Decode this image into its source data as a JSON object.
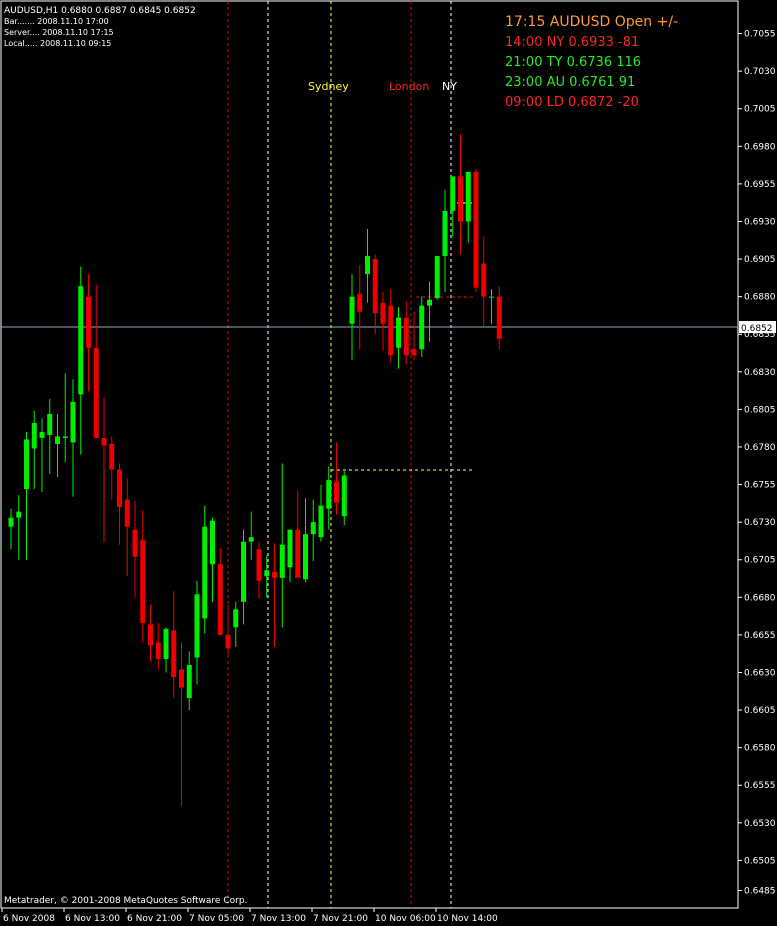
{
  "header": {
    "symbol_line": "AUDUSD,H1  0.6880 0.6887 0.6845 0.6852",
    "bar_line": "Bar....... 2008.11.10 17:00",
    "server_line": "Server.... 2008.11.10 17:15",
    "local_line": "Local..... 2008.11.10 09:15"
  },
  "sessions_panel": {
    "title": "17:15 AUDUSD Open +/-",
    "rows": [
      {
        "text": "14:00 NY  0.6933 -81",
        "color": "#ff2222"
      },
      {
        "text": "21:00 TY  0.6736 116",
        "color": "#22ee22"
      },
      {
        "text": "23:00 AU  0.6761 91",
        "color": "#22ee22"
      },
      {
        "text": "09:00 LD  0.6872 -20",
        "color": "#ff2222"
      }
    ],
    "title_color": "#ff9933"
  },
  "session_labels": [
    {
      "text": "Sydney",
      "color": "#ffff33"
    },
    {
      "text": "London",
      "color": "#ff2222"
    },
    {
      "text": "NY",
      "color": "#ffffff"
    }
  ],
  "footer": {
    "copyright": "Metatrader, © 2001-2008 MetaQuotes Software Corp."
  },
  "colors": {
    "background": "#000000",
    "bull": "#00ee00",
    "bear": "#ee0000",
    "axis": "#ffffff",
    "price_line": "#8ab0c8"
  },
  "chart_data": {
    "type": "candlestick",
    "symbol": "AUDUSD",
    "timeframe": "H1",
    "ylim": [
      0.648,
      0.707
    ],
    "y_ticks": [
      "0.7055",
      "0.7030",
      "0.7005",
      "0.6980",
      "0.6955",
      "0.6930",
      "0.6905",
      "0.6880",
      "0.6855",
      "0.6830",
      "0.6805",
      "0.6780",
      "0.6755",
      "0.6730",
      "0.6705",
      "0.6680",
      "0.6655",
      "0.6630",
      "0.6605",
      "0.6580",
      "0.6555",
      "0.6530",
      "0.6505",
      "0.6485"
    ],
    "x_labels": [
      "6 Nov 2008",
      "6 Nov 13:00",
      "6 Nov 21:00",
      "7 Nov 05:00",
      "7 Nov 13:00",
      "7 Nov 21:00",
      "10 Nov 06:00",
      "10 Nov 14:00"
    ],
    "x_label_bar_index": [
      0,
      8,
      16,
      24,
      32,
      40,
      48,
      56
    ],
    "current_price": "0.6852",
    "candles": [
      {
        "o": 0.6727,
        "h": 0.6739,
        "l": 0.6712,
        "c": 0.6733
      },
      {
        "o": 0.6733,
        "h": 0.6748,
        "l": 0.6705,
        "c": 0.6737
      },
      {
        "o": 0.6752,
        "h": 0.679,
        "l": 0.6705,
        "c": 0.6785
      },
      {
        "o": 0.6779,
        "h": 0.6804,
        "l": 0.6752,
        "c": 0.6796
      },
      {
        "o": 0.6786,
        "h": 0.6799,
        "l": 0.675,
        "c": 0.679
      },
      {
        "o": 0.6788,
        "h": 0.6812,
        "l": 0.6762,
        "c": 0.6802
      },
      {
        "o": 0.6782,
        "h": 0.6802,
        "l": 0.676,
        "c": 0.6787
      },
      {
        "o": 0.6786,
        "h": 0.6829,
        "l": 0.677,
        "c": 0.6787
      },
      {
        "o": 0.6783,
        "h": 0.6825,
        "l": 0.6747,
        "c": 0.681
      },
      {
        "o": 0.6815,
        "h": 0.69,
        "l": 0.6775,
        "c": 0.6887
      },
      {
        "o": 0.688,
        "h": 0.6895,
        "l": 0.6817,
        "c": 0.6846
      },
      {
        "o": 0.6846,
        "h": 0.6888,
        "l": 0.6788,
        "c": 0.6786
      },
      {
        "o": 0.6786,
        "h": 0.6813,
        "l": 0.6717,
        "c": 0.6781
      },
      {
        "o": 0.6782,
        "h": 0.6787,
        "l": 0.6745,
        "c": 0.6765
      },
      {
        "o": 0.6765,
        "h": 0.6769,
        "l": 0.6715,
        "c": 0.674
      },
      {
        "o": 0.6745,
        "h": 0.6759,
        "l": 0.6694,
        "c": 0.6727
      },
      {
        "o": 0.6725,
        "h": 0.6744,
        "l": 0.668,
        "c": 0.6707
      },
      {
        "o": 0.6718,
        "h": 0.6738,
        "l": 0.665,
        "c": 0.6663
      },
      {
        "o": 0.6662,
        "h": 0.6675,
        "l": 0.6637,
        "c": 0.6648
      },
      {
        "o": 0.665,
        "h": 0.6663,
        "l": 0.6632,
        "c": 0.6639
      },
      {
        "o": 0.6639,
        "h": 0.666,
        "l": 0.663,
        "c": 0.6659
      },
      {
        "o": 0.6658,
        "h": 0.6684,
        "l": 0.6613,
        "c": 0.6627
      },
      {
        "o": 0.6632,
        "h": 0.665,
        "l": 0.6541,
        "c": 0.662
      },
      {
        "o": 0.6613,
        "h": 0.6644,
        "l": 0.6605,
        "c": 0.6635
      },
      {
        "o": 0.664,
        "h": 0.6691,
        "l": 0.6622,
        "c": 0.6682
      },
      {
        "o": 0.6666,
        "h": 0.6741,
        "l": 0.6656,
        "c": 0.6727
      },
      {
        "o": 0.6702,
        "h": 0.6733,
        "l": 0.6677,
        "c": 0.6731
      },
      {
        "o": 0.6702,
        "h": 0.6713,
        "l": 0.6655,
        "c": 0.6655
      },
      {
        "o": 0.6655,
        "h": 0.6675,
        "l": 0.6642,
        "c": 0.6646
      },
      {
        "o": 0.666,
        "h": 0.6677,
        "l": 0.6647,
        "c": 0.6672
      },
      {
        "o": 0.6677,
        "h": 0.6725,
        "l": 0.6662,
        "c": 0.6717
      },
      {
        "o": 0.6717,
        "h": 0.6737,
        "l": 0.6705,
        "c": 0.672
      },
      {
        "o": 0.6712,
        "h": 0.6717,
        "l": 0.6679,
        "c": 0.6691
      },
      {
        "o": 0.6694,
        "h": 0.6708,
        "l": 0.668,
        "c": 0.6698
      },
      {
        "o": 0.6697,
        "h": 0.6716,
        "l": 0.6647,
        "c": 0.6693
      },
      {
        "o": 0.6693,
        "h": 0.6769,
        "l": 0.666,
        "c": 0.6715
      },
      {
        "o": 0.67,
        "h": 0.6725,
        "l": 0.669,
        "c": 0.6725
      },
      {
        "o": 0.6725,
        "h": 0.6751,
        "l": 0.6706,
        "c": 0.6693
      },
      {
        "o": 0.6692,
        "h": 0.6746,
        "l": 0.669,
        "c": 0.6722
      },
      {
        "o": 0.6722,
        "h": 0.6745,
        "l": 0.6704,
        "c": 0.673
      },
      {
        "o": 0.672,
        "h": 0.6755,
        "l": 0.6717,
        "c": 0.6741
      },
      {
        "o": 0.6739,
        "h": 0.6767,
        "l": 0.6725,
        "c": 0.6758
      },
      {
        "o": 0.6757,
        "h": 0.6783,
        "l": 0.6735,
        "c": 0.6743
      },
      {
        "o": 0.6734,
        "h": 0.6764,
        "l": 0.6728,
        "c": 0.6761
      },
      {
        "o": 0.6862,
        "h": 0.6895,
        "l": 0.6838,
        "c": 0.688
      },
      {
        "o": 0.6882,
        "h": 0.6901,
        "l": 0.6845,
        "c": 0.687
      },
      {
        "o": 0.6895,
        "h": 0.6925,
        "l": 0.6876,
        "c": 0.6907
      },
      {
        "o": 0.6905,
        "h": 0.6908,
        "l": 0.6855,
        "c": 0.6869
      },
      {
        "o": 0.6876,
        "h": 0.6883,
        "l": 0.6844,
        "c": 0.6862
      },
      {
        "o": 0.6874,
        "h": 0.6885,
        "l": 0.6836,
        "c": 0.6841
      },
      {
        "o": 0.6846,
        "h": 0.6873,
        "l": 0.6832,
        "c": 0.6866
      },
      {
        "o": 0.6866,
        "h": 0.6877,
        "l": 0.6835,
        "c": 0.6841
      },
      {
        "o": 0.6845,
        "h": 0.687,
        "l": 0.6838,
        "c": 0.6841
      },
      {
        "o": 0.6845,
        "h": 0.688,
        "l": 0.684,
        "c": 0.6874
      },
      {
        "o": 0.6874,
        "h": 0.689,
        "l": 0.685,
        "c": 0.6878
      },
      {
        "o": 0.6879,
        "h": 0.69,
        "l": 0.6878,
        "c": 0.6907
      },
      {
        "o": 0.6907,
        "h": 0.6951,
        "l": 0.6883,
        "c": 0.6937
      },
      {
        "o": 0.6937,
        "h": 0.6958,
        "l": 0.692,
        "c": 0.696
      },
      {
        "o": 0.696,
        "h": 0.6988,
        "l": 0.6908,
        "c": 0.693
      },
      {
        "o": 0.693,
        "h": 0.6962,
        "l": 0.6916,
        "c": 0.6963
      },
      {
        "o": 0.6963,
        "h": 0.6965,
        "l": 0.6883,
        "c": 0.6886
      },
      {
        "o": 0.6902,
        "h": 0.692,
        "l": 0.686,
        "c": 0.688
      },
      {
        "o": 0.688,
        "h": 0.6885,
        "l": 0.6862,
        "c": 0.688
      },
      {
        "o": 0.688,
        "h": 0.6887,
        "l": 0.6845,
        "c": 0.6852
      }
    ]
  }
}
